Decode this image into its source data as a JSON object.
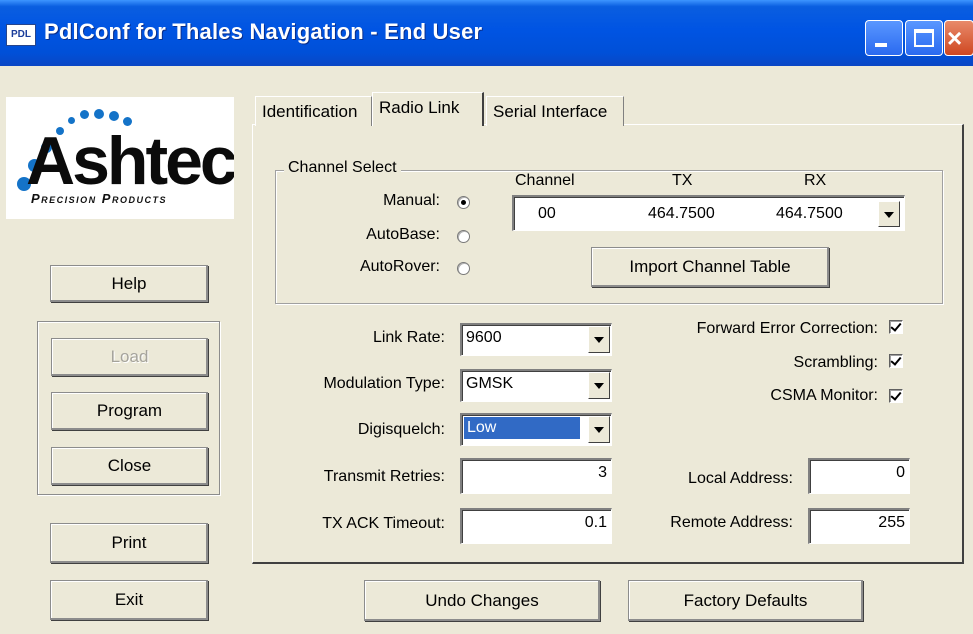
{
  "window": {
    "title": "PdlConf for Thales Navigation - End User",
    "icon_text": "PDL"
  },
  "logo": {
    "name": "Ashtech",
    "tagline": "Precision Products"
  },
  "buttons": {
    "help": "Help",
    "load": "Load",
    "program": "Program",
    "close": "Close",
    "print": "Print",
    "exit": "Exit",
    "undo": "Undo Changes",
    "factory": "Factory Defaults"
  },
  "tabs": [
    {
      "label": "Identification",
      "active": false
    },
    {
      "label": "Radio Link",
      "active": true
    },
    {
      "label": "Serial Interface",
      "active": false
    }
  ],
  "channel_select": {
    "legend": "Channel Select",
    "modes": [
      {
        "label": "Manual:",
        "selected": true
      },
      {
        "label": "AutoBase:",
        "selected": false
      },
      {
        "label": "AutoRover:",
        "selected": false
      }
    ],
    "columns": {
      "channel": "Channel",
      "tx": "TX",
      "rx": "RX"
    },
    "row": {
      "channel": "00",
      "tx": "464.7500",
      "rx": "464.7500"
    },
    "import_button": "Import Channel Table"
  },
  "fields": {
    "link_rate": {
      "label": "Link Rate:",
      "value": "9600"
    },
    "modulation": {
      "label": "Modulation Type:",
      "value": "GMSK"
    },
    "digisquelch": {
      "label": "Digisquelch:",
      "value": "Low"
    },
    "retries": {
      "label": "Transmit Retries:",
      "value": "3"
    },
    "ack_timeout": {
      "label": "TX ACK Timeout:",
      "value": "0.1"
    },
    "local_address": {
      "label": "Local Address:",
      "value": "0"
    },
    "remote_address": {
      "label": "Remote Address:",
      "value": "255"
    }
  },
  "checkboxes": {
    "fec": {
      "label": "Forward Error Correction:",
      "checked": true
    },
    "scrambling": {
      "label": "Scrambling:",
      "checked": true
    },
    "csma": {
      "label": "CSMA Monitor:",
      "checked": true
    }
  },
  "colors": {
    "titlebar": "#0054e3",
    "selection": "#316ac5",
    "face": "#ece9d8"
  }
}
